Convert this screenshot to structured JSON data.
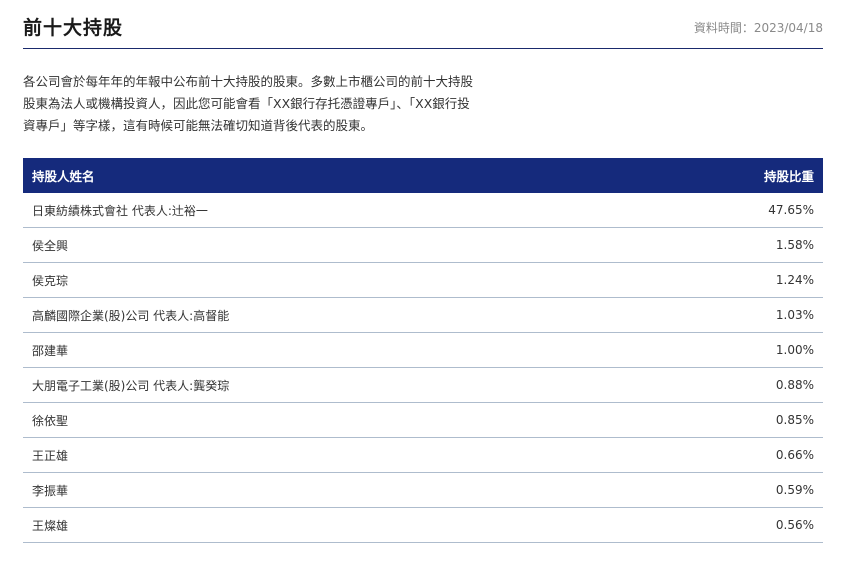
{
  "header": {
    "title": "前十大持股",
    "datetime": "資料時間：2023/04/18"
  },
  "description": "各公司會於每年年的年報中公布前十大持股的股東。多數上市櫃公司的前十大持股股東為法人或機構投資人，因此您可能會看「XX銀行存托憑證專戶」、「XX銀行投資專戶」等字樣，這有時候可能無法確切知道背後代表的股東。",
  "table": {
    "col_name": "持股人姓名",
    "col_pct": "持股比重",
    "rows": [
      {
        "name": "日東紡績株式會社 代表人:辻裕一",
        "pct": "47.65%"
      },
      {
        "name": "侯全興",
        "pct": "1.58%"
      },
      {
        "name": "侯克琮",
        "pct": "1.24%"
      },
      {
        "name": "高麟國際企業(股)公司 代表人:高督能",
        "pct": "1.03%"
      },
      {
        "name": "邵建華",
        "pct": "1.00%"
      },
      {
        "name": "大朋電子工業(股)公司 代表人:龔癸琮",
        "pct": "0.88%"
      },
      {
        "name": "徐依聖",
        "pct": "0.85%"
      },
      {
        "name": "王正雄",
        "pct": "0.66%"
      },
      {
        "name": "李振華",
        "pct": "0.59%"
      },
      {
        "name": "王燦雄",
        "pct": "0.56%"
      }
    ]
  }
}
